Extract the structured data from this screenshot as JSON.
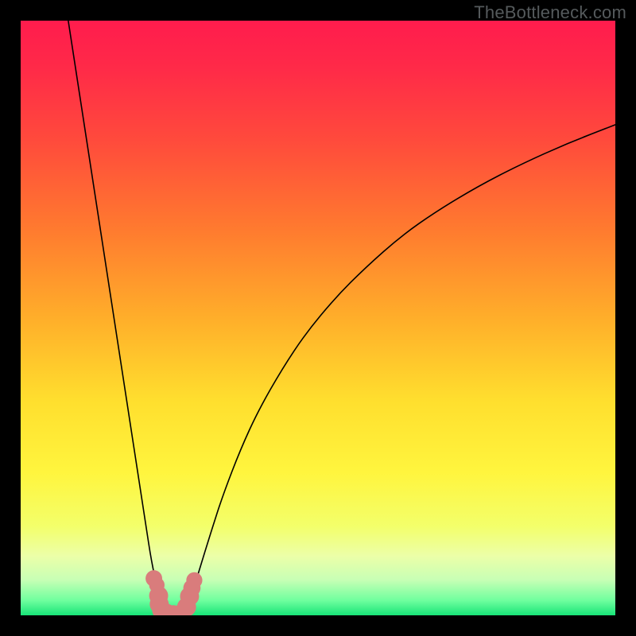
{
  "attribution": "TheBottleneck.com",
  "chart_data": {
    "type": "line",
    "title": "",
    "xlabel": "",
    "ylabel": "",
    "xlim": [
      0,
      100
    ],
    "ylim": [
      0,
      100
    ],
    "grid": false,
    "legend": false,
    "series": [
      {
        "name": "left-branch",
        "x": [
          8,
          10,
          12,
          14,
          16,
          18,
          20,
          21,
          22,
          23,
          23.5,
          24,
          24.5,
          25
        ],
        "y": [
          100,
          87,
          74,
          61,
          48,
          35,
          22,
          15.5,
          9,
          4.5,
          2.5,
          1.2,
          0.4,
          0
        ]
      },
      {
        "name": "right-branch",
        "x": [
          27,
          27.5,
          28,
          29,
          30,
          32,
          34,
          37,
          40,
          44,
          48,
          53,
          58,
          64,
          70,
          77,
          84,
          92,
          100
        ],
        "y": [
          0,
          0.6,
          1.6,
          4.2,
          7.5,
          14,
          20.2,
          28,
          34.5,
          41.5,
          47.5,
          53.5,
          58.5,
          63.8,
          68,
          72.2,
          75.8,
          79.4,
          82.5
        ]
      }
    ],
    "markers": [
      {
        "x": 22.4,
        "y": 6.2,
        "r": 1.4
      },
      {
        "x": 22.9,
        "y": 5.1,
        "r": 1.3
      },
      {
        "x": 23.2,
        "y": 3.3,
        "r": 1.6
      },
      {
        "x": 23.3,
        "y": 1.9,
        "r": 1.6
      },
      {
        "x": 23.7,
        "y": 0.9,
        "r": 1.6
      },
      {
        "x": 24.6,
        "y": 0.35,
        "r": 1.55
      },
      {
        "x": 25.7,
        "y": 0.2,
        "r": 1.5
      },
      {
        "x": 26.8,
        "y": 0.25,
        "r": 1.5
      },
      {
        "x": 27.9,
        "y": 1.4,
        "r": 1.6
      },
      {
        "x": 28.4,
        "y": 3.2,
        "r": 1.6
      },
      {
        "x": 28.8,
        "y": 4.6,
        "r": 1.45
      },
      {
        "x": 29.2,
        "y": 5.9,
        "r": 1.35
      }
    ],
    "gradient_stops": [
      {
        "offset": 0,
        "color": "#ff1c4d"
      },
      {
        "offset": 0.08,
        "color": "#ff2a48"
      },
      {
        "offset": 0.2,
        "color": "#ff4a3c"
      },
      {
        "offset": 0.35,
        "color": "#ff7a2f"
      },
      {
        "offset": 0.5,
        "color": "#ffae2a"
      },
      {
        "offset": 0.64,
        "color": "#ffdf2e"
      },
      {
        "offset": 0.76,
        "color": "#fff53e"
      },
      {
        "offset": 0.85,
        "color": "#f3ff6a"
      },
      {
        "offset": 0.9,
        "color": "#ecffa8"
      },
      {
        "offset": 0.94,
        "color": "#c8ffb5"
      },
      {
        "offset": 0.975,
        "color": "#6fff9e"
      },
      {
        "offset": 1.0,
        "color": "#18e478"
      }
    ]
  }
}
